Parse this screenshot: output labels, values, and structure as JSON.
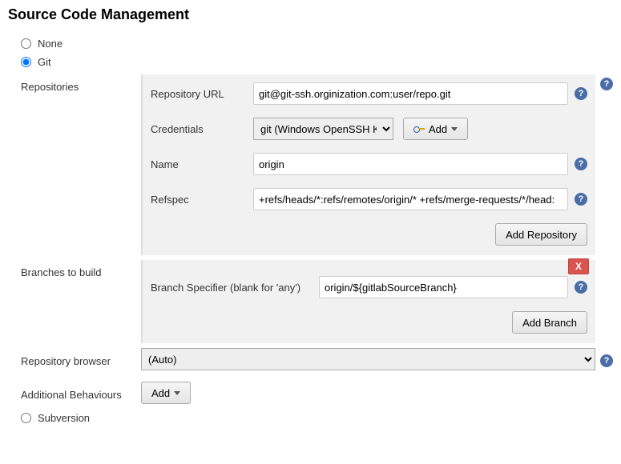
{
  "section_title": "Source Code Management",
  "options": {
    "none_label": "None",
    "git_label": "Git",
    "subversion_label": "Subversion",
    "selected": "git"
  },
  "repositories": {
    "section_label": "Repositories",
    "url_label": "Repository URL",
    "url_value": "git@git-ssh.orginization.com:user/repo.git",
    "credentials_label": "Credentials",
    "credentials_value": "git (Windows OpenSSH Key)",
    "add_cred_label": "Add",
    "name_label": "Name",
    "name_value": "origin",
    "refspec_label": "Refspec",
    "refspec_value": "+refs/heads/*:refs/remotes/origin/* +refs/merge-requests/*/head:",
    "add_repo_label": "Add Repository"
  },
  "branches": {
    "section_label": "Branches to build",
    "specifier_label": "Branch Specifier (blank for 'any')",
    "specifier_value": "origin/${gitlabSourceBranch}",
    "add_branch_label": "Add Branch",
    "delete_label": "X"
  },
  "repo_browser": {
    "section_label": "Repository browser",
    "value": "(Auto)"
  },
  "additional": {
    "section_label": "Additional Behaviours",
    "add_label": "Add"
  },
  "help_tooltip": "?"
}
